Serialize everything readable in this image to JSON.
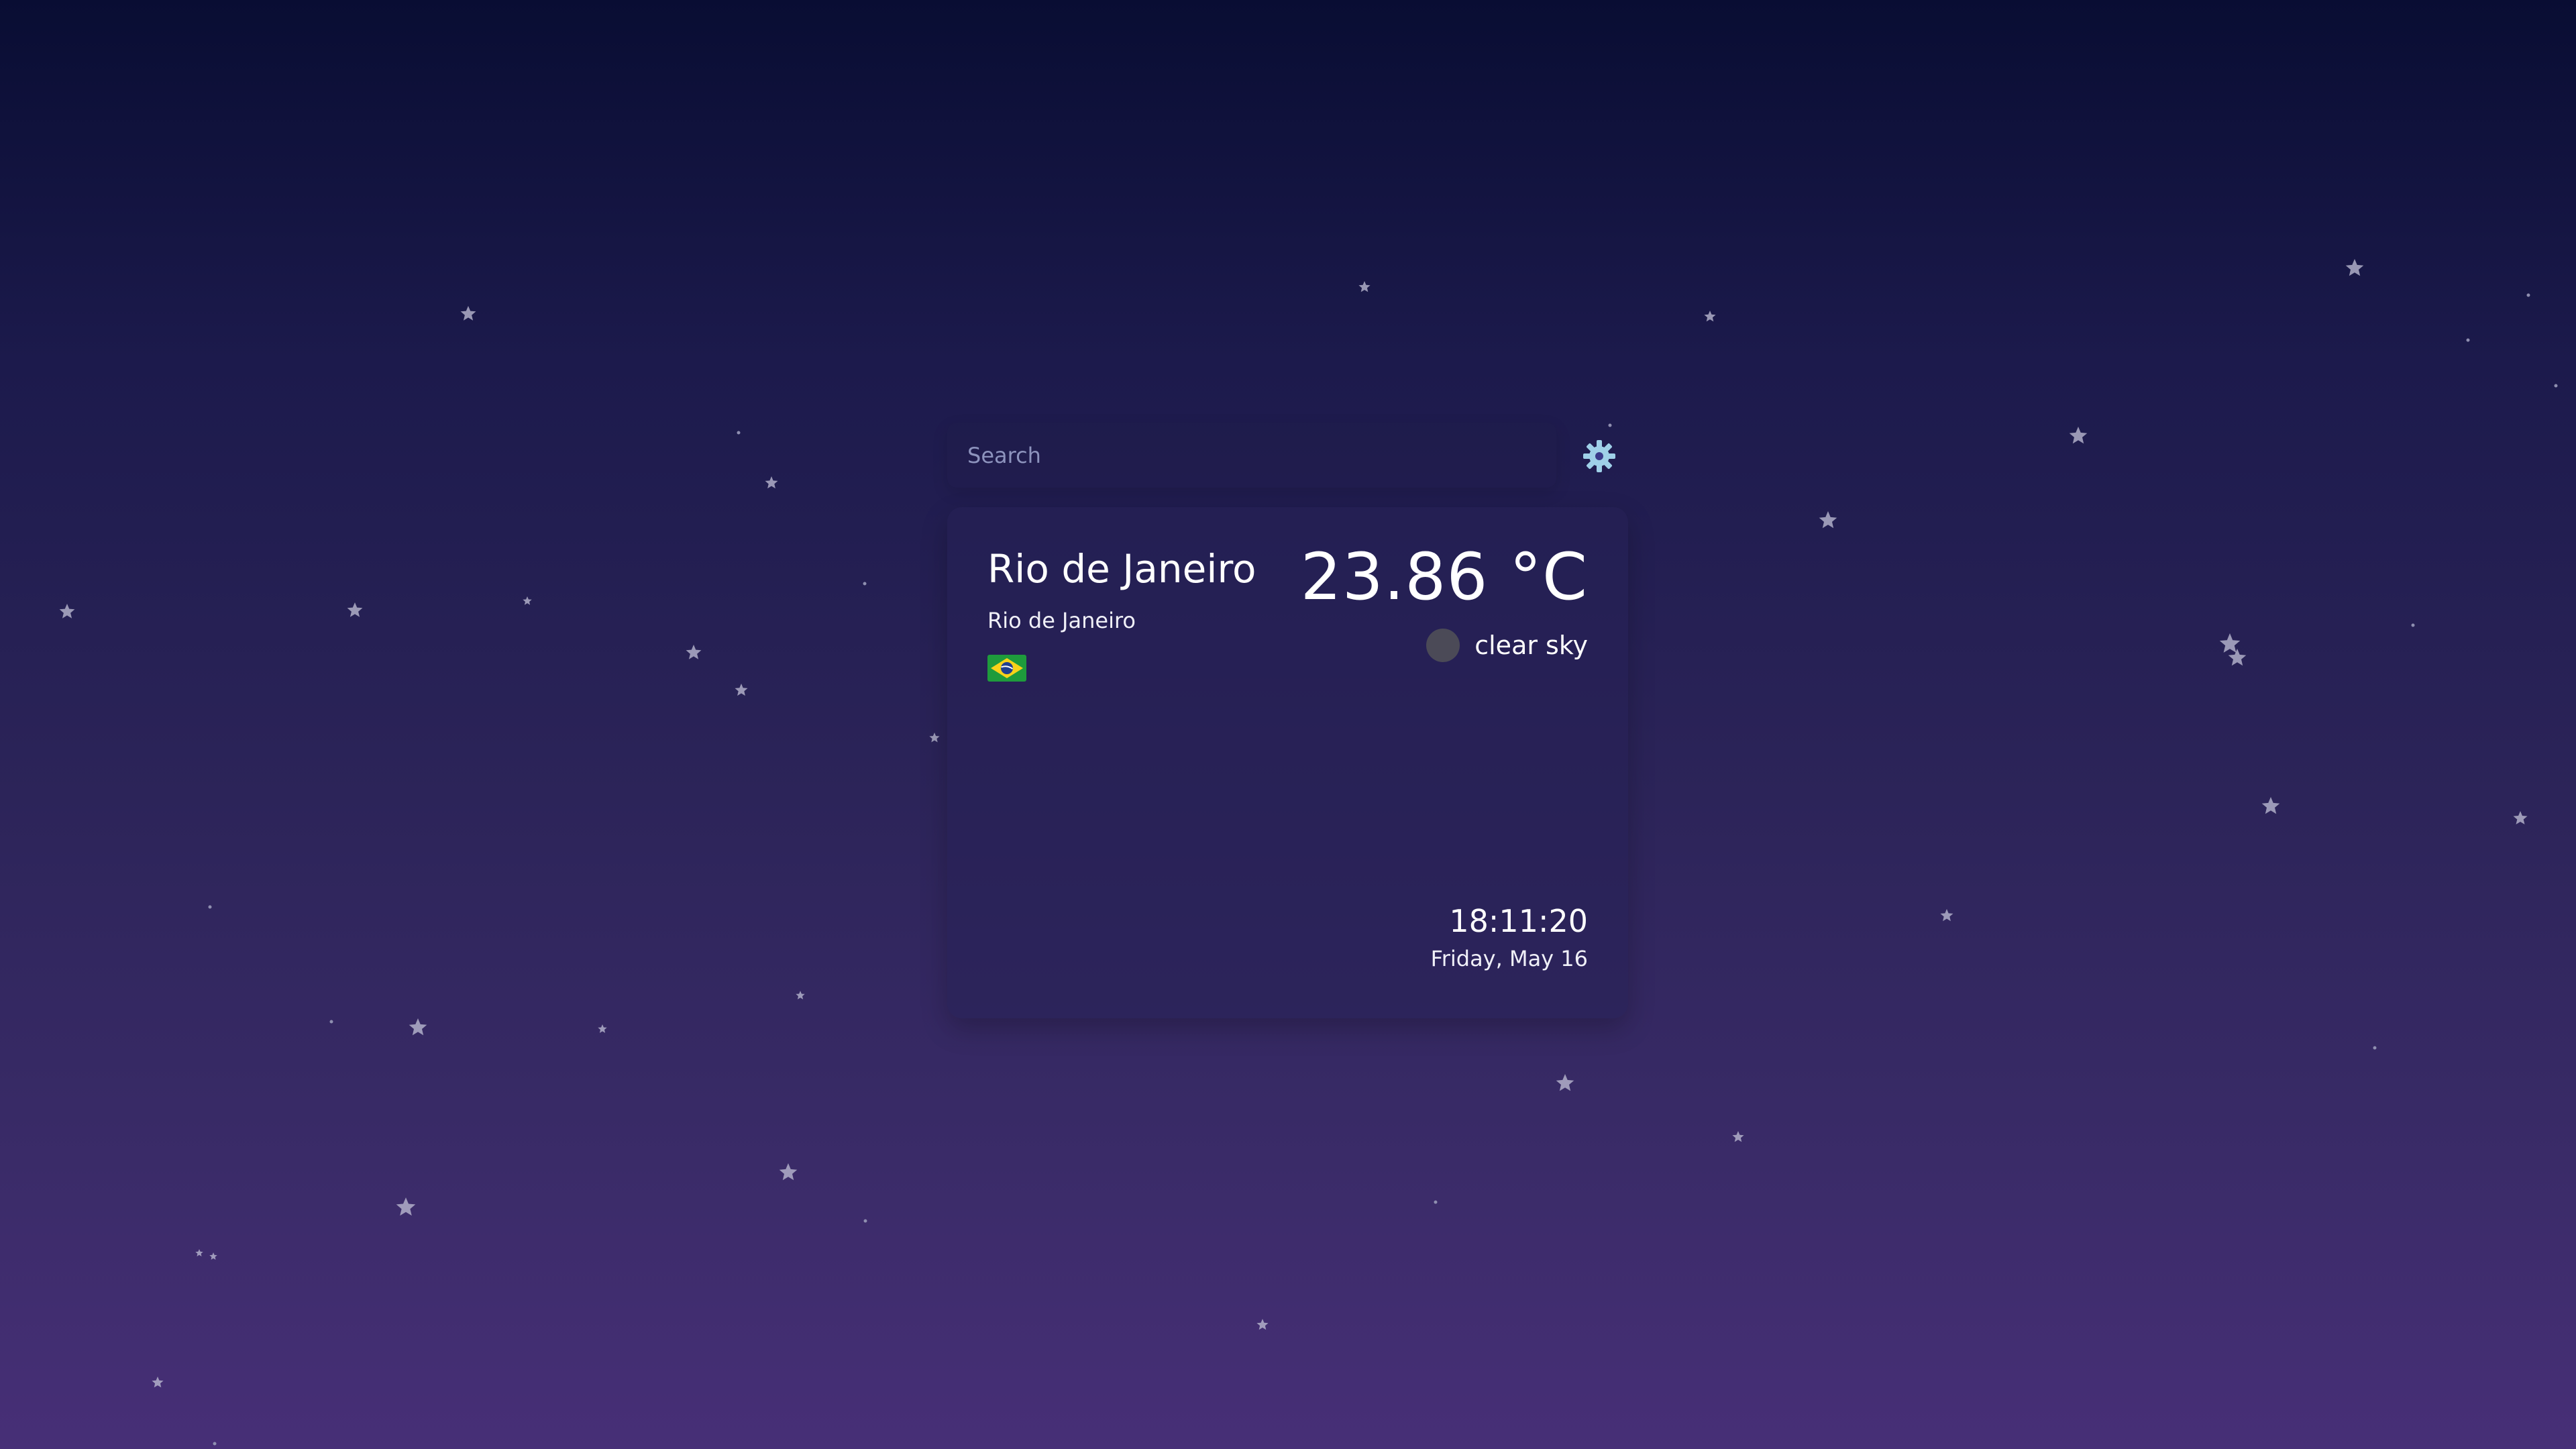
{
  "search": {
    "placeholder": "Search",
    "settings_icon": "gear-icon"
  },
  "weather": {
    "city": "Rio de Janeiro",
    "region": "Rio de Janeiro",
    "country_flag": "brazil-flag-icon",
    "temperature": "23.86 °C",
    "condition": "clear sky",
    "condition_icon": "weather-condition-icon",
    "time": "18:11:20",
    "date": "Friday, May 16"
  },
  "colors": {
    "accent_gear": "#9fd0e8",
    "condition_icon": "#4b4a57"
  }
}
